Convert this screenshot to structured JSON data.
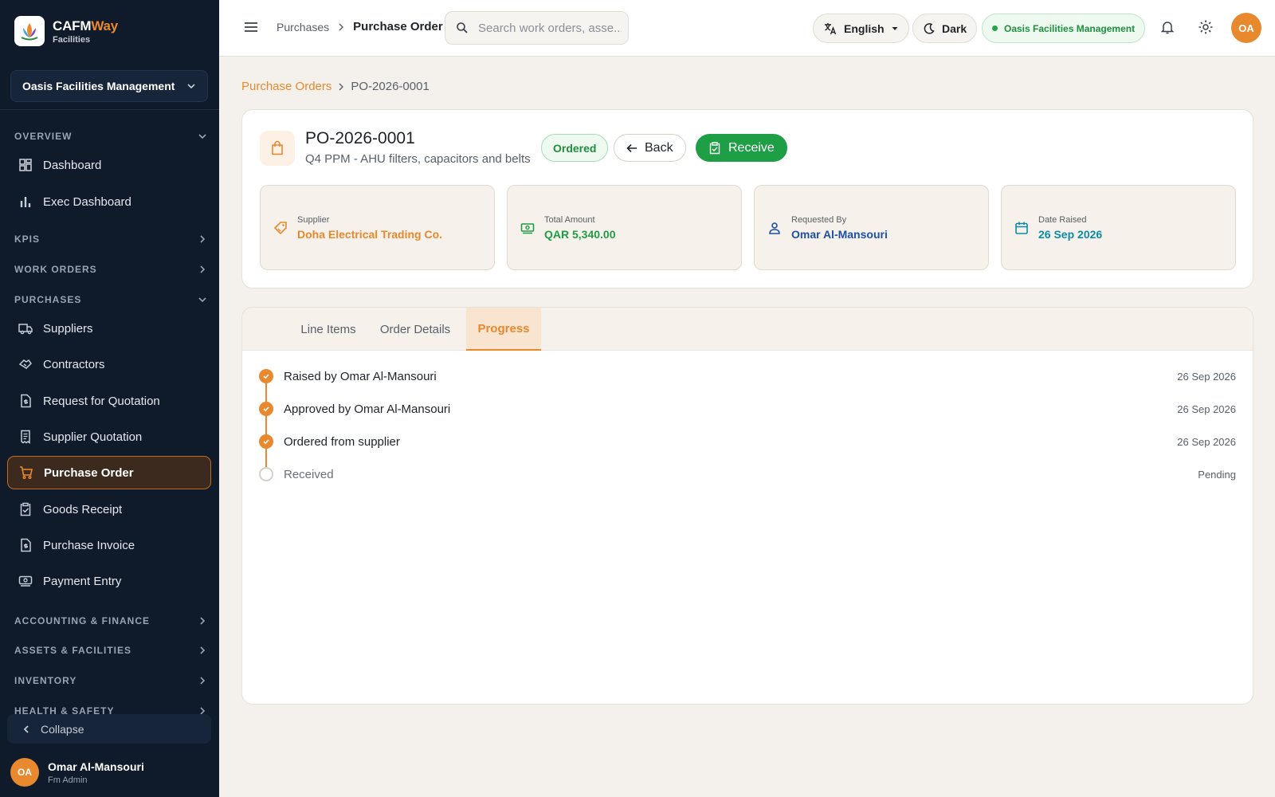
{
  "brand": {
    "name_part1": "CAFM",
    "name_part2": "Way",
    "subtitle": "Facilities"
  },
  "sidebar": {
    "org_selector": "Oasis Facilities Management",
    "sections": {
      "overview": "OVERVIEW",
      "kpis": "KPIS",
      "work_orders": "WORK ORDERS",
      "purchases": "PURCHASES",
      "accounting": "ACCOUNTING & FINANCE",
      "assets": "ASSETS & FACILITIES",
      "inventory": "INVENTORY",
      "health": "HEALTH & SAFETY"
    },
    "items": {
      "dashboard": "Dashboard",
      "exec_dashboard": "Exec Dashboard",
      "suppliers": "Suppliers",
      "contractors": "Contractors",
      "rfq": "Request for Quotation",
      "supplier_quotation": "Supplier Quotation",
      "purchase_order": "Purchase Order",
      "goods_receipt": "Goods Receipt",
      "purchase_invoice": "Purchase Invoice",
      "payment_entry": "Payment Entry"
    },
    "collapse_label": "Collapse",
    "user": {
      "initials": "OA",
      "name": "Omar Al-Mansouri",
      "role": "Fm Admin"
    }
  },
  "topbar": {
    "breadcrumb_parent": "Purchases",
    "breadcrumb_current": "Purchase Order",
    "search_placeholder": "Search work orders, asse...",
    "language": "English",
    "theme": "Dark",
    "org": "Oasis Facilities Management",
    "avatar_initials": "OA"
  },
  "page": {
    "breadcrumb_link": "Purchase Orders",
    "breadcrumb_current": "PO-2026-0001",
    "po_number": "PO-2026-0001",
    "po_description": "Q4 PPM - AHU filters, capacitors and belts",
    "status": "Ordered",
    "back_label": "Back",
    "receive_label": "Receive",
    "info": {
      "supplier_label": "Supplier",
      "supplier_value": "Doha Electrical Trading Co.",
      "amount_label": "Total Amount",
      "amount_value": "QAR 5,340.00",
      "requested_label": "Requested By",
      "requested_value": "Omar Al-Mansouri",
      "date_label": "Date Raised",
      "date_value": "26 Sep 2026"
    },
    "tabs": [
      "Line Items",
      "Order Details",
      "Progress"
    ],
    "steps": [
      {
        "label": "Raised by Omar Al-Mansouri",
        "date": "26 Sep 2026"
      },
      {
        "label": "Approved by Omar Al-Mansouri",
        "date": "26 Sep 2026"
      },
      {
        "label": "Ordered from supplier",
        "date": "26 Sep 2026"
      },
      {
        "label": "Received",
        "date": "Pending"
      }
    ]
  },
  "colors": {
    "accent": "#e8892e",
    "success": "#1e9e45",
    "sidebar_bg": "#0f1a2b",
    "info_blue": "#1f4fa6",
    "info_teal": "#0f8aa6"
  },
  "icons": [
    "menu-icon",
    "search-icon",
    "translate-icon",
    "moon-icon",
    "bell-icon",
    "gear-icon",
    "shopping-bag-icon",
    "arrow-left-icon",
    "receive-icon",
    "tag-icon",
    "cash-icon",
    "user-icon",
    "calendar-icon",
    "check-icon"
  ]
}
